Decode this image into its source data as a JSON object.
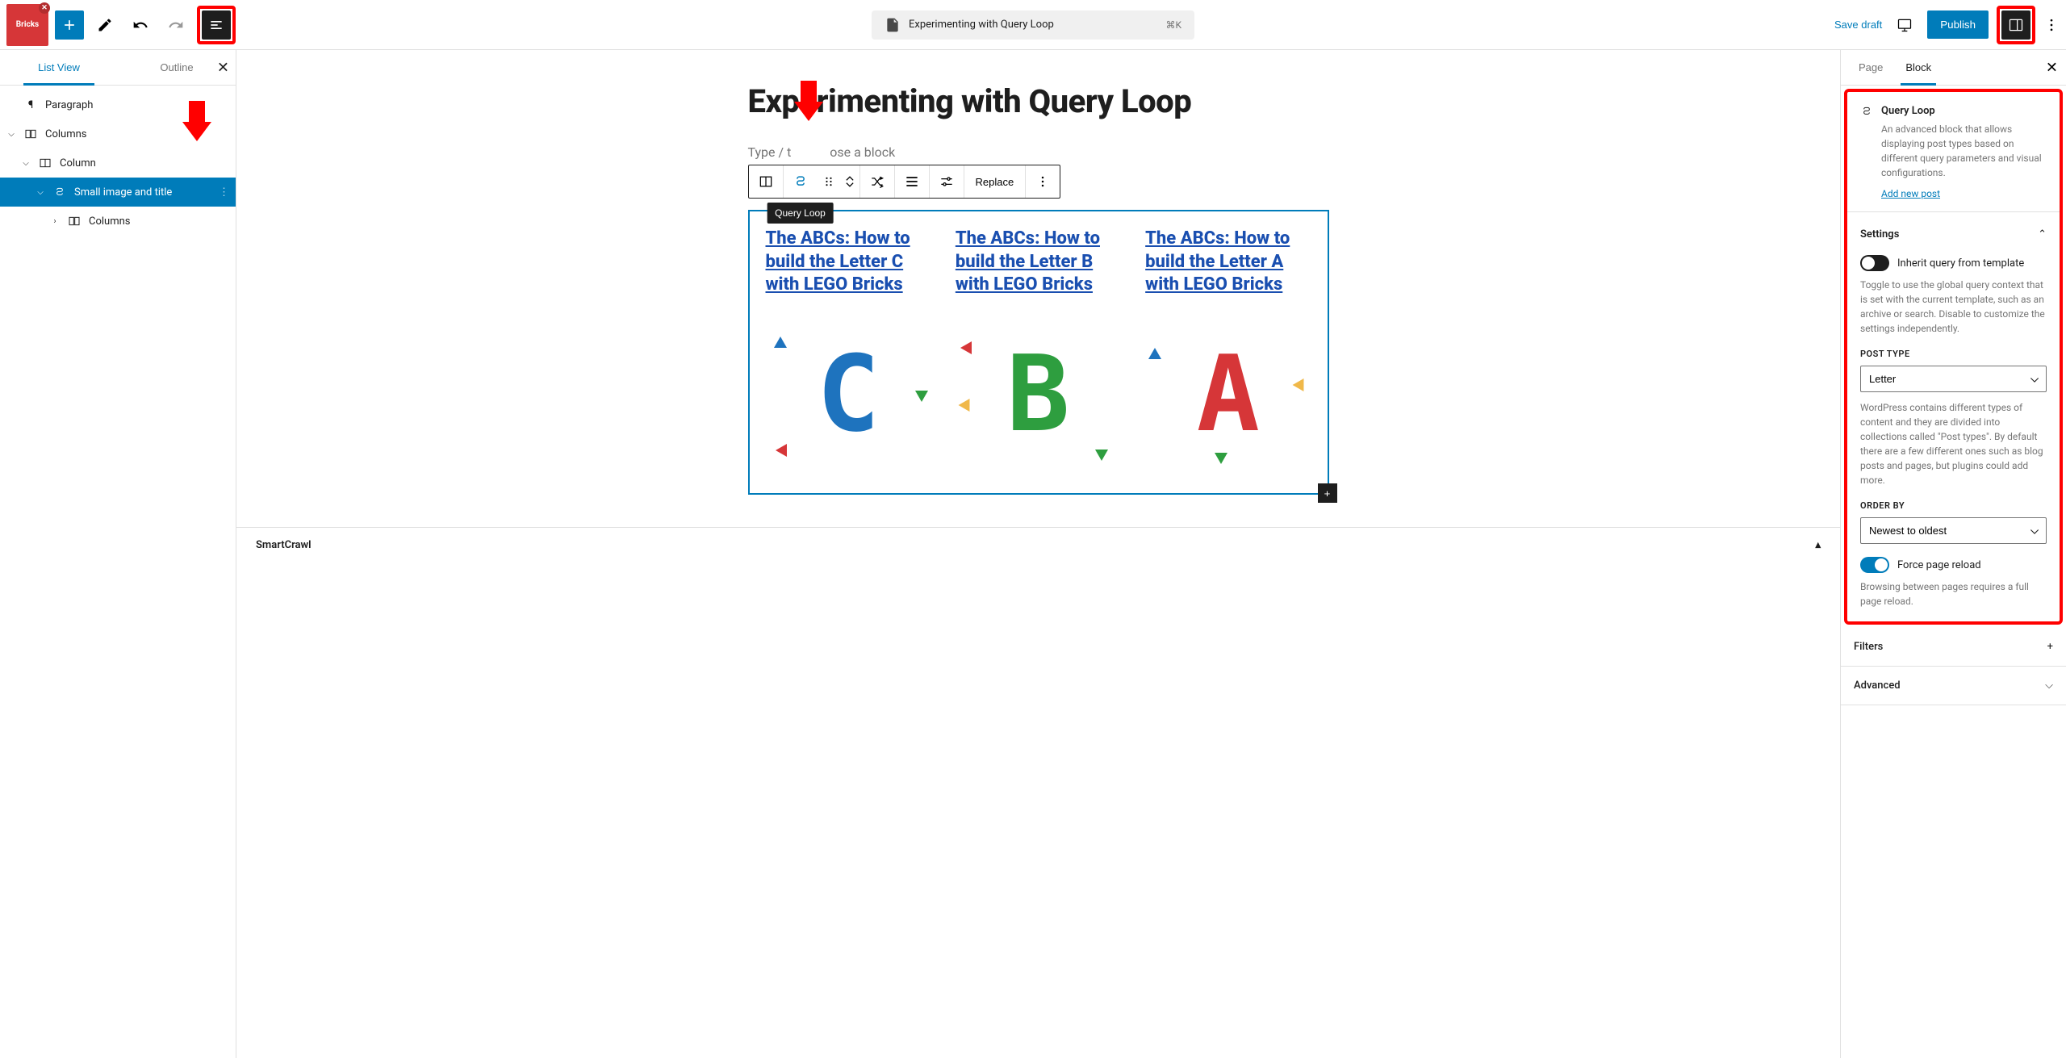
{
  "topbar": {
    "doc_title": "Experimenting with Query Loop",
    "shortcut": "⌘K",
    "save_draft": "Save draft",
    "publish": "Publish"
  },
  "left_panel": {
    "tabs": {
      "list_view": "List View",
      "outline": "Outline"
    },
    "tree": [
      {
        "label": "Paragraph",
        "icon": "paragraph",
        "indent": 0,
        "caret": ""
      },
      {
        "label": "Columns",
        "icon": "columns",
        "indent": 0,
        "caret": "v"
      },
      {
        "label": "Column",
        "icon": "column",
        "indent": 1,
        "caret": "v"
      },
      {
        "label": "Small image and title",
        "icon": "loop",
        "indent": 2,
        "caret": "v",
        "selected": true
      },
      {
        "label": "Columns",
        "icon": "columns",
        "indent": 3,
        "caret": ">"
      }
    ]
  },
  "editor": {
    "post_title": "Experimenting with Query Loop",
    "prompt_prefix": "Type / t",
    "prompt_suffix": "ose a block",
    "toolbar": {
      "tooltip": "Query Loop",
      "replace": "Replace"
    },
    "posts": [
      {
        "title": "The ABCs: How to build the Letter C with LEGO Bricks",
        "letter": "C",
        "cls": "lego-c"
      },
      {
        "title": "The ABCs: How to build the Letter B with LEGO Bricks",
        "letter": "B",
        "cls": "lego-b"
      },
      {
        "title": "The ABCs: How to build the Letter A with LEGO Bricks",
        "letter": "A",
        "cls": "lego-a"
      }
    ],
    "footer": "SmartCrawl"
  },
  "right_panel": {
    "tabs": {
      "page": "Page",
      "block": "Block"
    },
    "block_info": {
      "name": "Query Loop",
      "desc": "An advanced block that allows displaying post types based on different query parameters and visual configurations.",
      "add_new": "Add new post"
    },
    "settings": {
      "title": "Settings",
      "inherit_label": "Inherit query from template",
      "inherit_help": "Toggle to use the global query context that is set with the current template, such as an archive or search. Disable to customize the settings independently.",
      "post_type_label": "POST TYPE",
      "post_type_value": "Letter",
      "post_type_help": "WordPress contains different types of content and they are divided into collections called \"Post types\". By default there are a few different ones such as blog posts and pages, but plugins could add more.",
      "order_by_label": "ORDER BY",
      "order_by_value": "Newest to oldest",
      "force_reload_label": "Force page reload",
      "force_reload_help": "Browsing between pages requires a full page reload."
    },
    "filters": "Filters",
    "advanced": "Advanced"
  }
}
